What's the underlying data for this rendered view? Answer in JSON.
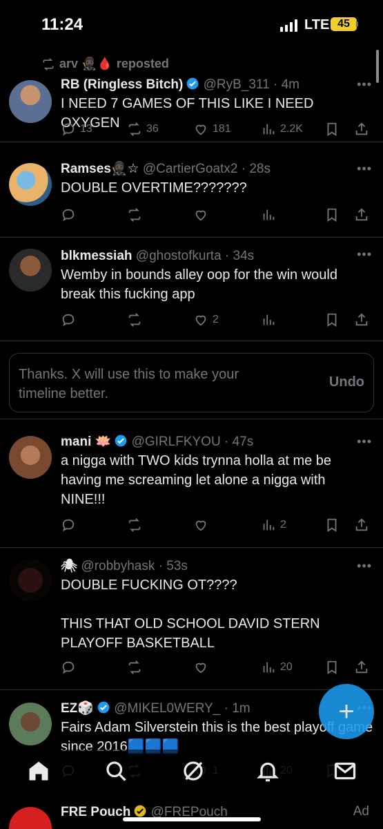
{
  "status_bar": {
    "time": "11:24",
    "network": "LTE",
    "battery": "45"
  },
  "repost_header": {
    "user": "arv 🥷🏿🩸",
    "label": "reposted"
  },
  "posts": [
    {
      "name": "RB (Ringless Bitch)",
      "handle": "@RyB_311",
      "time": "4m",
      "text": "I NEED 7 GAMES OF THIS LIKE I NEED OXYGEN",
      "replies": "13",
      "reposts": "36",
      "likes": "181",
      "views": "2.2K"
    },
    {
      "name": "Ramses🥷🏿☆",
      "handle": "@CartierGoatx2",
      "time": "28s",
      "text": "DOUBLE OVERTIME???????",
      "replies": "",
      "reposts": "",
      "likes": "",
      "views": ""
    },
    {
      "name": "blkmessiah",
      "handle": "@ghostofkurta",
      "time": "34s",
      "text": "Wemby in bounds alley oop for the win would break this fucking app",
      "replies": "",
      "reposts": "",
      "likes": "2",
      "views": ""
    },
    {
      "name": "mani 🪷",
      "handle": "@GIRLFKYOU",
      "time": "47s",
      "text": "a nigga with TWO kids trynna holla at me be having me screaming let alone a nigga with NINE!!!",
      "replies": "",
      "reposts": "",
      "likes": "",
      "views": "2"
    },
    {
      "name": "🕷",
      "handle": "@robbyhask",
      "time": "53s",
      "text": "DOUBLE FUCKING OT????",
      "text2": "THIS THAT OLD SCHOOL DAVID STERN PLAYOFF BASKETBALL",
      "replies": "",
      "reposts": "",
      "likes": "",
      "views": "20"
    },
    {
      "name": "EZ🎲",
      "handle": "@MIKEL0WERY_",
      "time": "1m",
      "text": "Fairs Adam Silverstein this is the best playoff game since 2016🟦🟦🟦",
      "replies": "",
      "reposts": "",
      "likes": "1",
      "views": "20"
    }
  ],
  "feedback": {
    "text": "Thanks. X will use this to make your timeline better.",
    "undo_label": "Undo"
  },
  "ad": {
    "name": "FRE Pouch",
    "handle": "@FREPouch",
    "label": "Ad"
  },
  "colors": {
    "background": "#000000",
    "accent": "#1d9bf0",
    "muted": "#71767b",
    "divider": "#2f3336"
  }
}
